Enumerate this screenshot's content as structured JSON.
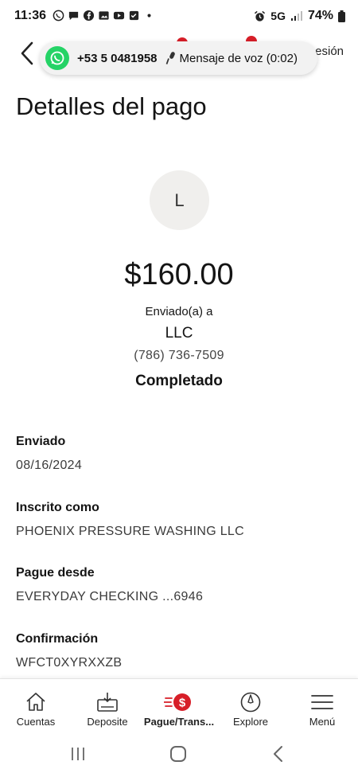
{
  "status_bar": {
    "time": "11:36",
    "network": "5G",
    "battery": "74%"
  },
  "header": {
    "right_text": "esión"
  },
  "whatsapp_overlay": {
    "number": "+53 5 0481958",
    "voice_message": "Mensaje de voz (0:02)"
  },
  "page": {
    "title": "Detalles del pago",
    "avatar_letter": "L",
    "amount": "$160.00",
    "sent_to_label": "Enviado(a) a",
    "recipient": "LLC",
    "phone": "(786) 736-7509",
    "status": "Completado"
  },
  "details": [
    {
      "label": "Enviado",
      "value": "08/16/2024"
    },
    {
      "label": "Inscrito como",
      "value": "PHOENIX PRESSURE WASHING LLC"
    },
    {
      "label": "Pague desde",
      "value": "EVERYDAY CHECKING ...6946"
    },
    {
      "label": "Confirmación",
      "value": "WFCT0XYRXXZB"
    }
  ],
  "bottom_nav": [
    {
      "label": "Cuentas",
      "icon": "home-icon"
    },
    {
      "label": "Deposite",
      "icon": "deposit-icon"
    },
    {
      "label": "Pague/Trans...",
      "icon": "pay-transfer-icon",
      "active": true
    },
    {
      "label": "Explore",
      "icon": "compass-icon"
    },
    {
      "label": "Menú",
      "icon": "menu-icon"
    }
  ],
  "colors": {
    "brand_red": "#d71e28",
    "whatsapp_green": "#25d366",
    "avatar_bg": "#f0efed"
  }
}
